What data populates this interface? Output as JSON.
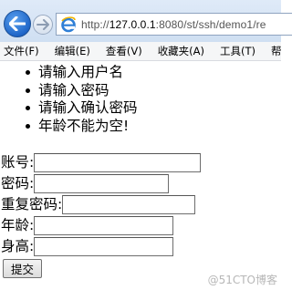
{
  "browser": {
    "back_icon": "back-arrow-icon",
    "forward_icon": "forward-arrow-icon",
    "site_icon": "internet-explorer-icon",
    "url_prefix": "http://",
    "url_host": "127.0.0.1",
    "url_path": ":8080/st/ssh/demo1/re"
  },
  "menu": {
    "items": [
      "文件(F)",
      "编辑(E)",
      "查看(V)",
      "收藏夹(A)",
      "工具(T)",
      "帮助"
    ]
  },
  "errors": {
    "items": [
      "请输入用户名",
      "请输入密码",
      "请输入确认密码",
      "年龄不能为空!"
    ]
  },
  "form": {
    "fields": [
      {
        "label": "账号:",
        "value": ""
      },
      {
        "label": "密码:",
        "value": ""
      },
      {
        "label": "重复密码:",
        "value": ""
      },
      {
        "label": "年龄:",
        "value": ""
      },
      {
        "label": "身高:",
        "value": ""
      }
    ],
    "submit_label": "提交"
  },
  "watermark": "@51CTO博客"
}
